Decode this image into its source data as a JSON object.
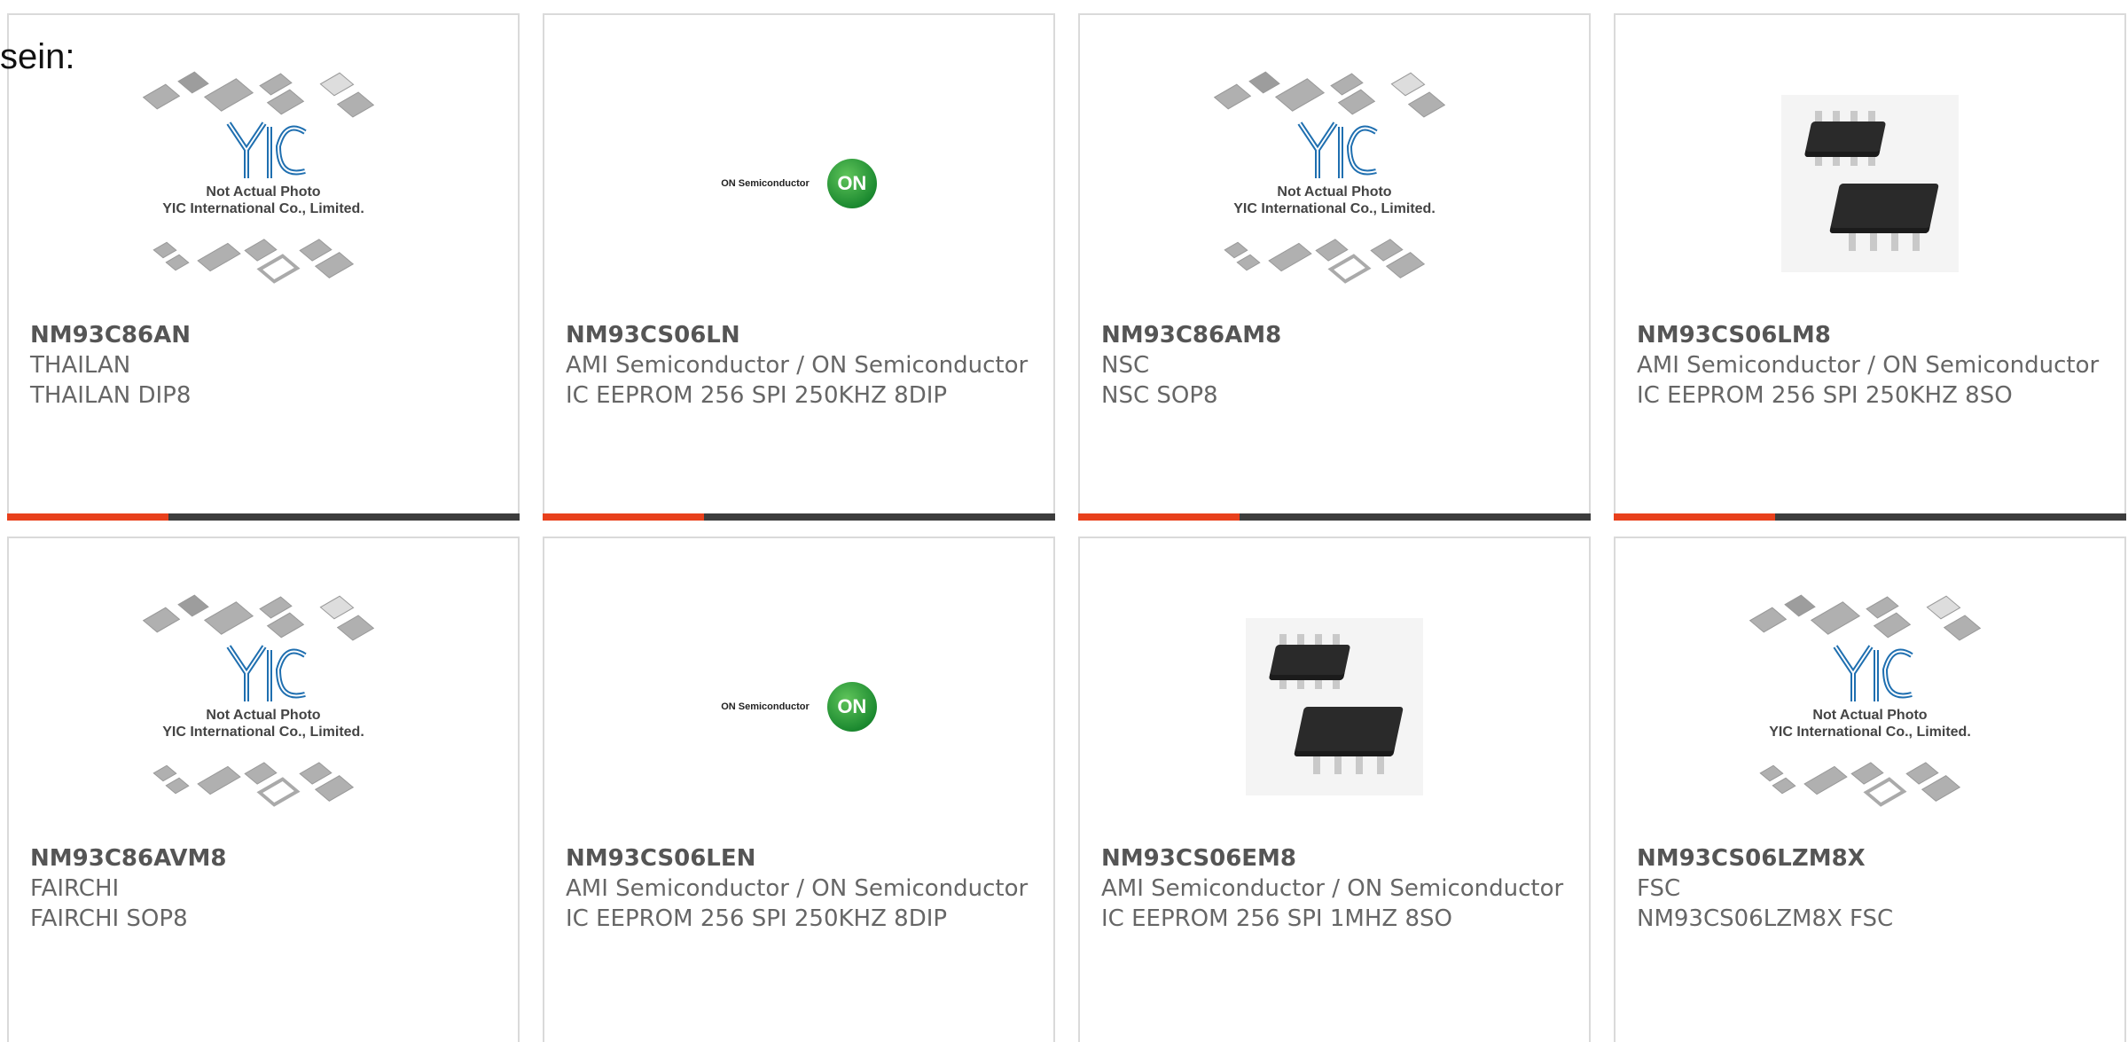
{
  "lead_text": "sein:",
  "colors": {
    "accent": "#e8401c",
    "bar": "#3d3d3d",
    "border": "#dadada"
  },
  "placeholder": {
    "line1": "Not Actual Photo",
    "line2": "YIC International Co., Limited."
  },
  "on_logo": {
    "text": "ON Semiconductor",
    "mark": "ON"
  },
  "products": [
    {
      "part": "NM93C86AN",
      "line1": "THAILAN",
      "line2": "THAILAN DIP8",
      "image": "yic-placeholder"
    },
    {
      "part": "NM93CS06LN",
      "line1": "AMI Semiconductor / ON Semiconductor",
      "line2": "IC EEPROM 256 SPI 250KHZ 8DIP",
      "image": "on-semiconductor-logo"
    },
    {
      "part": "NM93C86AM8",
      "line1": "NSC",
      "line2": "NSC SOP8",
      "image": "yic-placeholder"
    },
    {
      "part": "NM93CS06LM8",
      "line1": "AMI Semiconductor / ON Semiconductor",
      "line2": "IC EEPROM 256 SPI 250KHZ 8SO",
      "image": "sop8-photo"
    },
    {
      "part": "NM93C86AVM8",
      "line1": "FAIRCHI",
      "line2": "FAIRCHI SOP8",
      "image": "yic-placeholder"
    },
    {
      "part": "NM93CS06LEN",
      "line1": "AMI Semiconductor / ON Semiconductor",
      "line2": "IC EEPROM 256 SPI 250KHZ 8DIP",
      "image": "on-semiconductor-logo"
    },
    {
      "part": "NM93CS06EM8",
      "line1": "AMI Semiconductor / ON Semiconductor",
      "line2": "IC EEPROM 256 SPI 1MHZ 8SO",
      "image": "sop8-photo"
    },
    {
      "part": "NM93CS06LZM8X",
      "line1": "FSC",
      "line2": "NM93CS06LZM8X FSC",
      "image": "yic-placeholder"
    }
  ]
}
